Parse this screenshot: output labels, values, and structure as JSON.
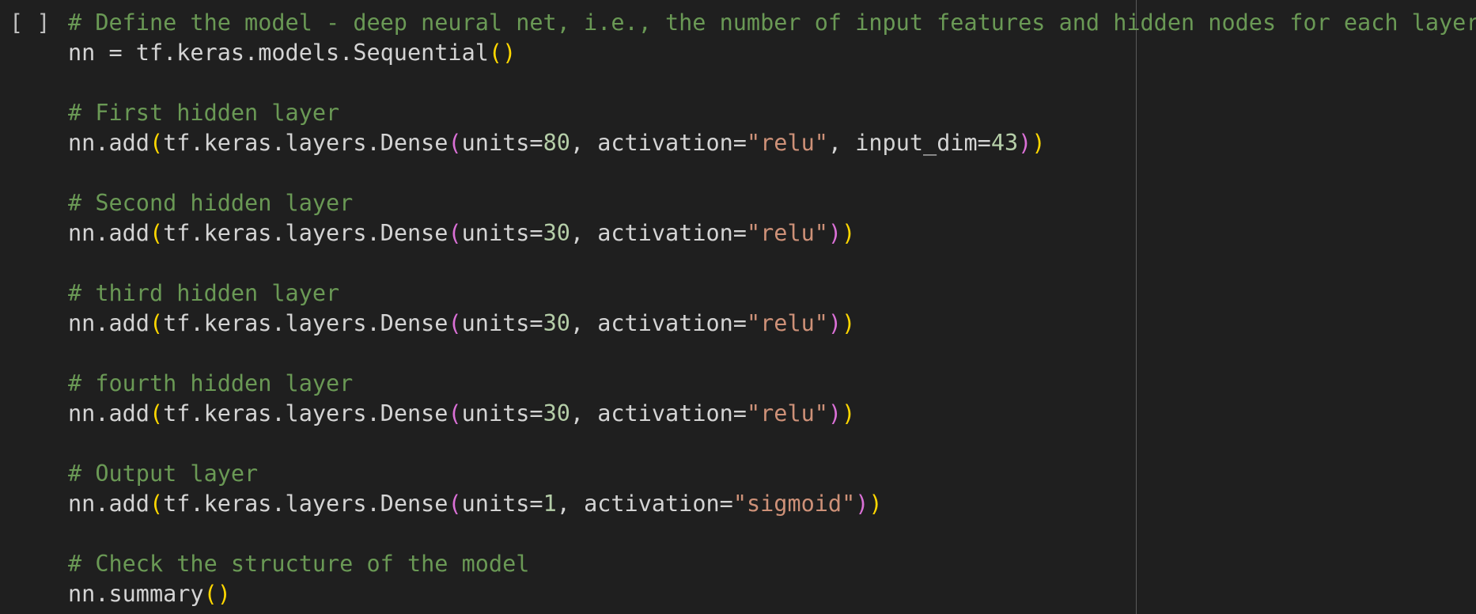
{
  "cell": {
    "run_indicator": "[ ]",
    "lines": [
      [
        {
          "t": "# Define the model - deep neural net, i.e., the number of input features and hidden nodes for each layer.",
          "c": "cm"
        }
      ],
      [
        {
          "t": "nn = tf.keras.models.Sequential",
          "c": "tx"
        },
        {
          "t": "()",
          "c": "b1"
        }
      ],
      [],
      [
        {
          "t": "# First hidden layer",
          "c": "cm"
        }
      ],
      [
        {
          "t": "nn.add",
          "c": "tx"
        },
        {
          "t": "(",
          "c": "b1"
        },
        {
          "t": "tf.keras.layers.Dense",
          "c": "tx"
        },
        {
          "t": "(",
          "c": "b2"
        },
        {
          "t": "units=",
          "c": "tx"
        },
        {
          "t": "80",
          "c": "num"
        },
        {
          "t": ", activation=",
          "c": "tx"
        },
        {
          "t": "\"relu\"",
          "c": "str"
        },
        {
          "t": ", input_dim=",
          "c": "tx"
        },
        {
          "t": "43",
          "c": "num"
        },
        {
          "t": ")",
          "c": "b2"
        },
        {
          "t": ")",
          "c": "b1"
        }
      ],
      [],
      [
        {
          "t": "# Second hidden layer",
          "c": "cm"
        }
      ],
      [
        {
          "t": "nn.add",
          "c": "tx"
        },
        {
          "t": "(",
          "c": "b1"
        },
        {
          "t": "tf.keras.layers.Dense",
          "c": "tx"
        },
        {
          "t": "(",
          "c": "b2"
        },
        {
          "t": "units=",
          "c": "tx"
        },
        {
          "t": "30",
          "c": "num"
        },
        {
          "t": ", activation=",
          "c": "tx"
        },
        {
          "t": "\"relu\"",
          "c": "str"
        },
        {
          "t": ")",
          "c": "b2"
        },
        {
          "t": ")",
          "c": "b1"
        }
      ],
      [],
      [
        {
          "t": "# third hidden layer",
          "c": "cm"
        }
      ],
      [
        {
          "t": "nn.add",
          "c": "tx"
        },
        {
          "t": "(",
          "c": "b1"
        },
        {
          "t": "tf.keras.layers.Dense",
          "c": "tx"
        },
        {
          "t": "(",
          "c": "b2"
        },
        {
          "t": "units=",
          "c": "tx"
        },
        {
          "t": "30",
          "c": "num"
        },
        {
          "t": ", activation=",
          "c": "tx"
        },
        {
          "t": "\"relu\"",
          "c": "str"
        },
        {
          "t": ")",
          "c": "b2"
        },
        {
          "t": ")",
          "c": "b1"
        }
      ],
      [],
      [
        {
          "t": "# fourth hidden layer",
          "c": "cm"
        }
      ],
      [
        {
          "t": "nn.add",
          "c": "tx"
        },
        {
          "t": "(",
          "c": "b1"
        },
        {
          "t": "tf.keras.layers.Dense",
          "c": "tx"
        },
        {
          "t": "(",
          "c": "b2"
        },
        {
          "t": "units=",
          "c": "tx"
        },
        {
          "t": "30",
          "c": "num"
        },
        {
          "t": ", activation=",
          "c": "tx"
        },
        {
          "t": "\"relu\"",
          "c": "str"
        },
        {
          "t": ")",
          "c": "b2"
        },
        {
          "t": ")",
          "c": "b1"
        }
      ],
      [],
      [
        {
          "t": "# Output layer",
          "c": "cm"
        }
      ],
      [
        {
          "t": "nn.add",
          "c": "tx"
        },
        {
          "t": "(",
          "c": "b1"
        },
        {
          "t": "tf.keras.layers.Dense",
          "c": "tx"
        },
        {
          "t": "(",
          "c": "b2"
        },
        {
          "t": "units=",
          "c": "tx"
        },
        {
          "t": "1",
          "c": "num"
        },
        {
          "t": ", activation=",
          "c": "tx"
        },
        {
          "t": "\"sigmoid\"",
          "c": "str"
        },
        {
          "t": ")",
          "c": "b2"
        },
        {
          "t": ")",
          "c": "b1"
        }
      ],
      [],
      [
        {
          "t": "# Check the structure of the model",
          "c": "cm"
        }
      ],
      [
        {
          "t": "nn.summary",
          "c": "tx"
        },
        {
          "t": "()",
          "c": "b1"
        }
      ]
    ]
  },
  "colors": {
    "background": "#1f1f1f",
    "comment": "#6a9955",
    "text": "#d4d4d4",
    "number": "#b5cea8",
    "string": "#ce9178",
    "bracket_outer": "#ffd700",
    "bracket_inner": "#da70d6"
  }
}
